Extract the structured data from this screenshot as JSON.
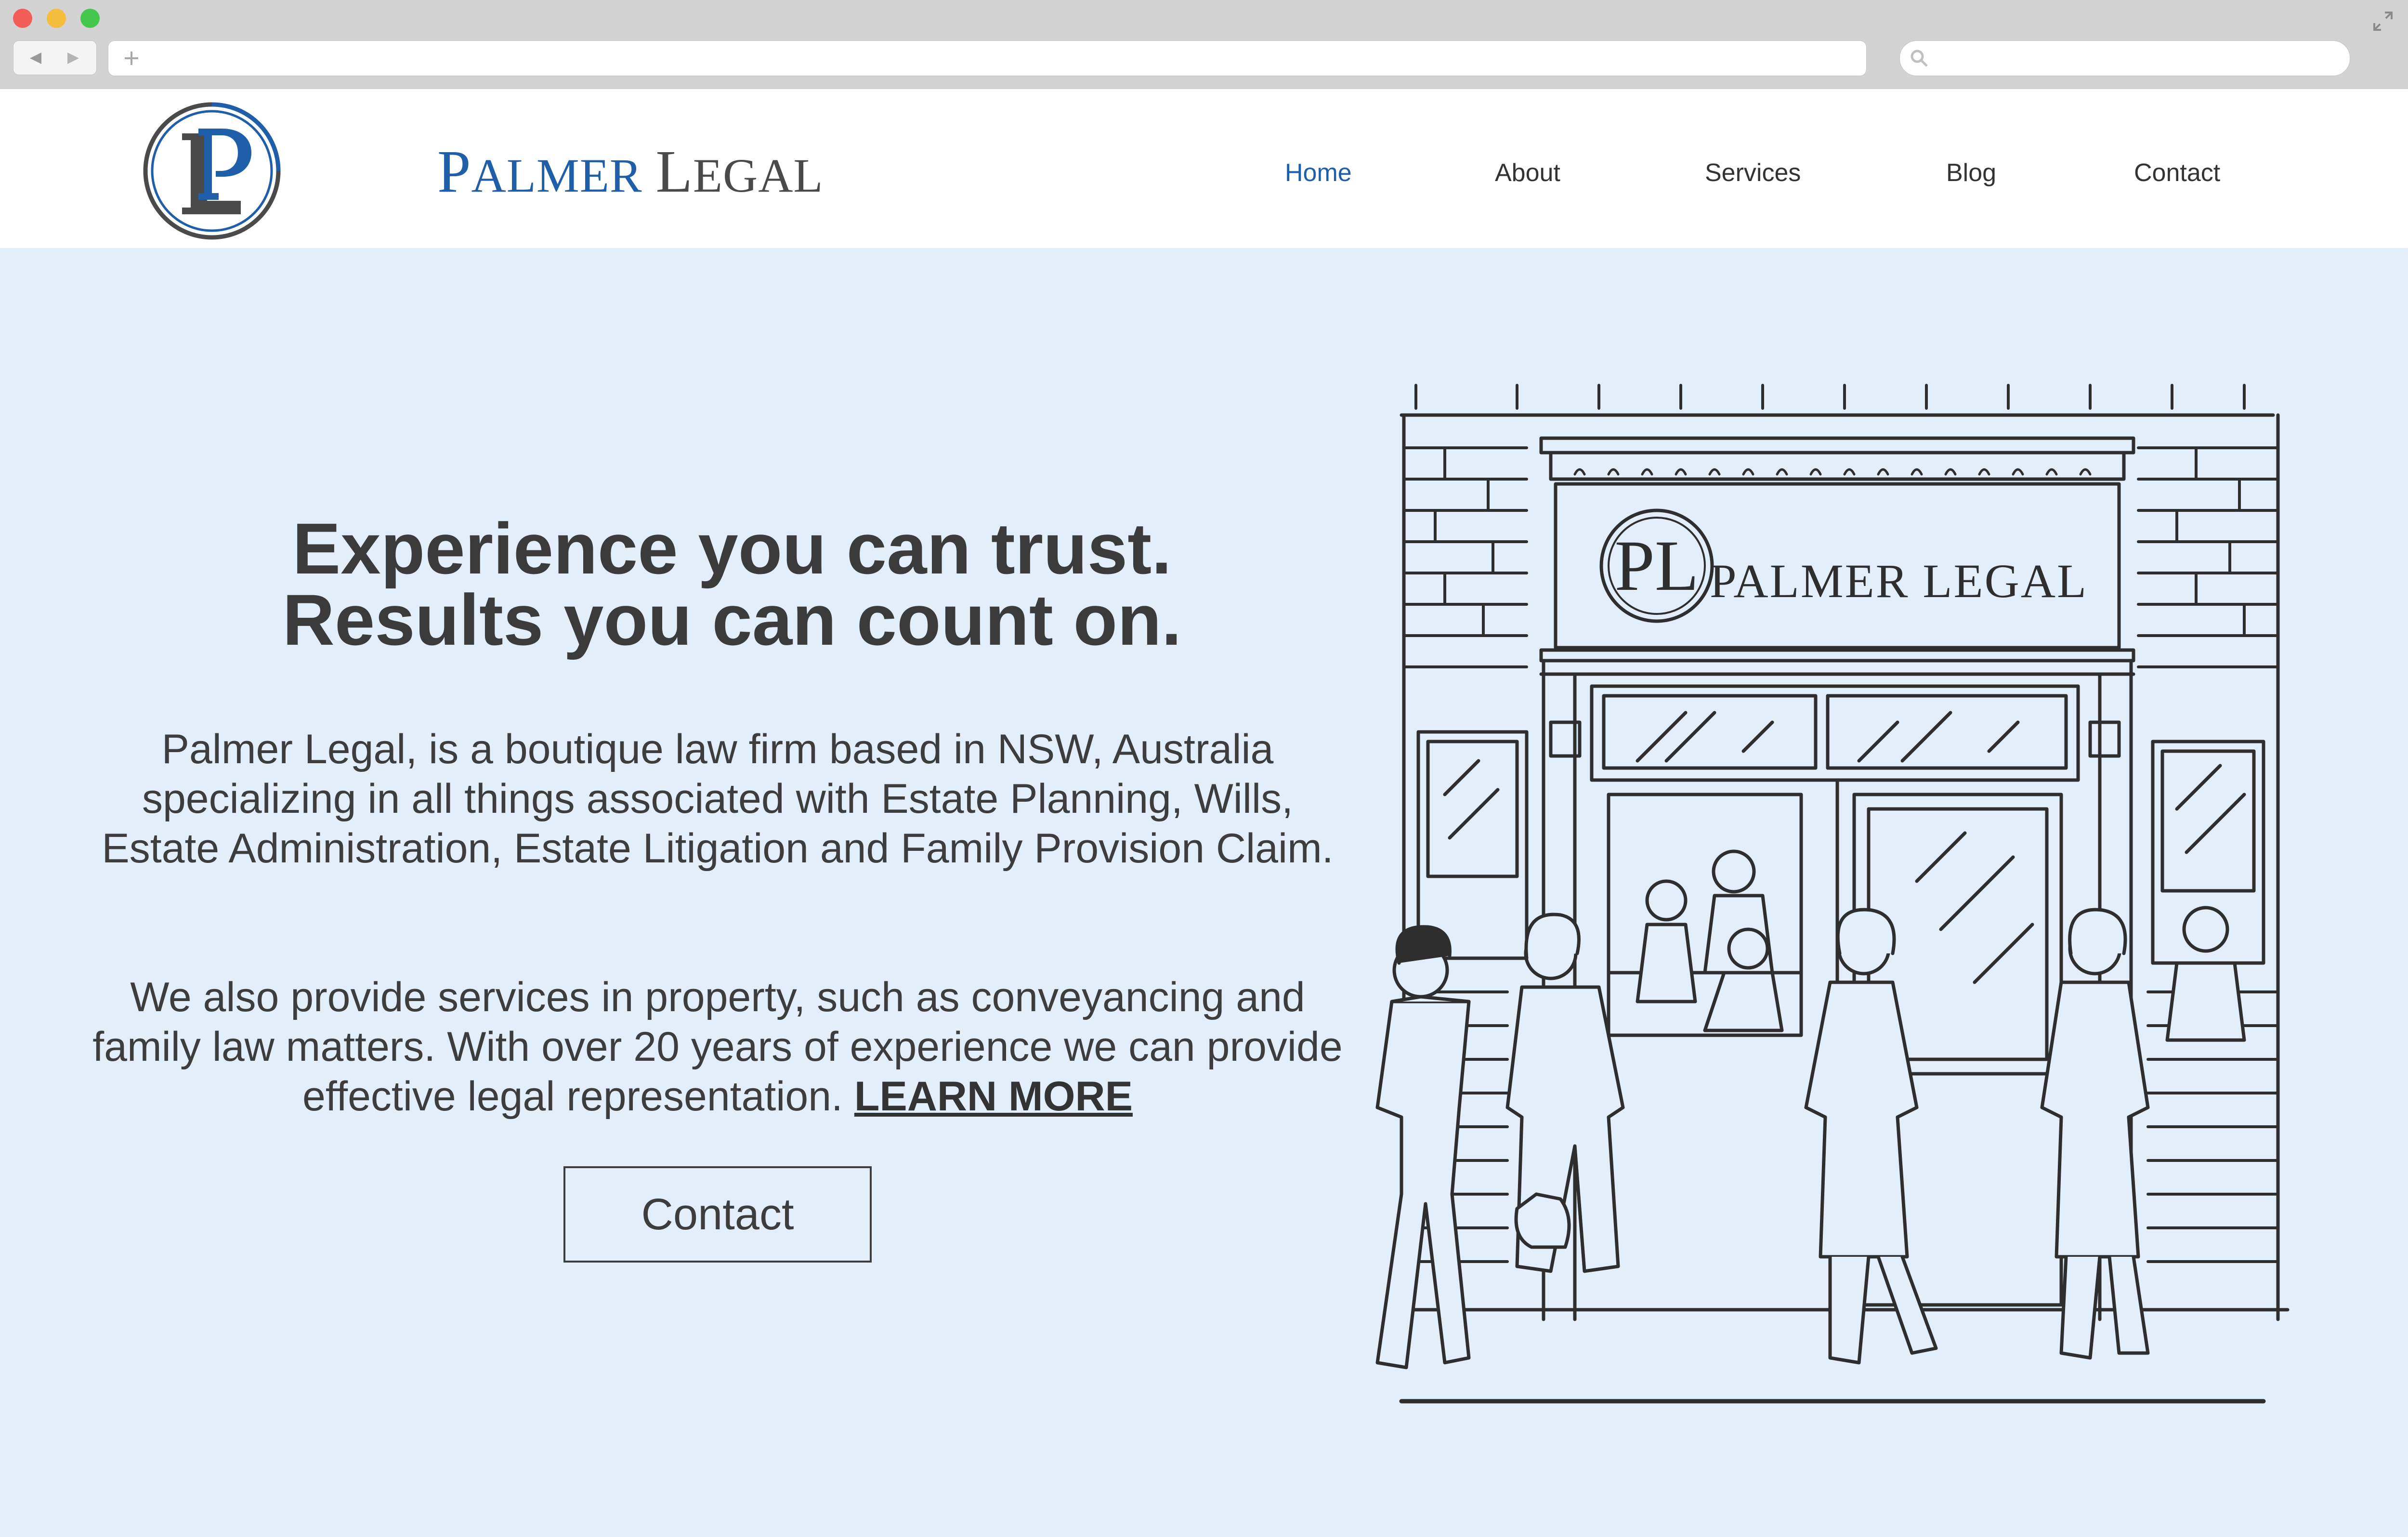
{
  "browser": {
    "window_controls": [
      "close",
      "minimize",
      "maximize"
    ],
    "icons": [
      "back-arrow-icon",
      "forward-arrow-icon",
      "new-tab-plus-icon",
      "search-icon",
      "expand-icon"
    ],
    "url": "",
    "search": ""
  },
  "header": {
    "logo_letters": "PL",
    "brand": {
      "word1_initial": "P",
      "word1_rest": "ALMER",
      "word2_initial": "L",
      "word2_rest": "EGAL"
    },
    "nav": [
      {
        "label": "Home",
        "active": true
      },
      {
        "label": "About",
        "active": false
      },
      {
        "label": "Services",
        "active": false
      },
      {
        "label": "Blog",
        "active": false
      },
      {
        "label": "Contact",
        "active": false
      }
    ]
  },
  "hero": {
    "headline_line1": "Experience you can trust.",
    "headline_line2": "Results you can count on.",
    "paragraph1": "Palmer Legal, is a boutique law firm based in NSW, Australia specializing in all things associated with Estate Planning, Wills, Estate Administration, Estate Litigation and Family Provision Claim.",
    "paragraph2": "We also provide services in property, such as conveyancing and family law matters. With over 20 years of experience we can provide effective legal representation.",
    "learn_more": "LEARN MORE",
    "contact_button": "Contact"
  },
  "illustration": {
    "sign_logo": "PL",
    "sign_text": "PALMER LEGAL"
  },
  "colors": {
    "brand_blue": "#1f5ea8",
    "brand_gray": "#4a4a4a",
    "page_background": "#e3eefb",
    "chrome_gray": "#d3d3d3"
  }
}
